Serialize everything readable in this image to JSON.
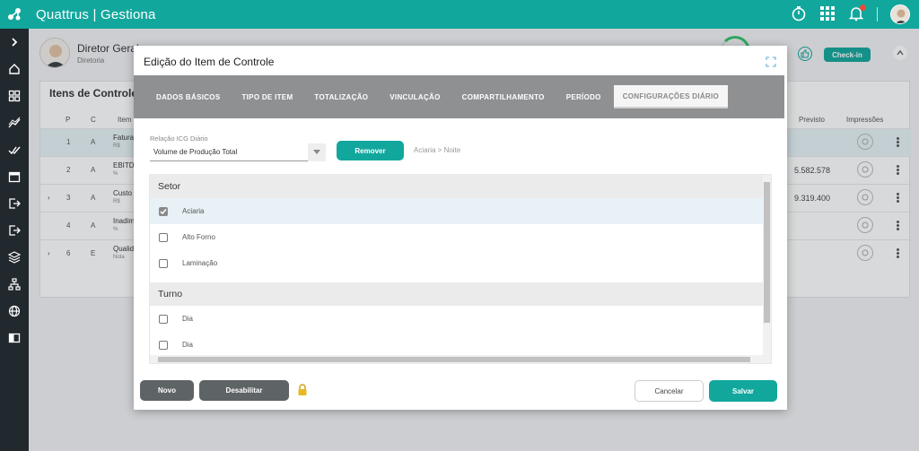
{
  "app": {
    "brand": "Quattrus | Gestiona"
  },
  "user": {
    "name": "Diretor Geral",
    "role": "Diretoria"
  },
  "checkin_label": "Check-in",
  "panel": {
    "title": "Itens de Controle | 5",
    "columns": {
      "p": "P",
      "c": "C",
      "item": "Item",
      "previsto": "Previsto",
      "impressoes": "Impressões"
    },
    "rows": [
      {
        "p": "1",
        "c": "A",
        "item": "Fatura",
        "unit": "R$",
        "previsto": "",
        "expand": ""
      },
      {
        "p": "2",
        "c": "A",
        "item": "EBITDA",
        "unit": "%",
        "previsto": "5.582.578",
        "expand": ""
      },
      {
        "p": "3",
        "c": "A",
        "item": "Custo",
        "unit": "R$",
        "previsto": "9.319.400",
        "expand": "›"
      },
      {
        "p": "4",
        "c": "A",
        "item": "Inadim",
        "unit": "%",
        "previsto": "",
        "expand": ""
      },
      {
        "p": "6",
        "c": "E",
        "item": "Qualid",
        "unit": "Nota",
        "previsto": "",
        "expand": "›"
      }
    ]
  },
  "modal": {
    "title": "Edição do Item de Controle",
    "tabs": [
      "DADOS BÁSICOS",
      "TIPO DE ITEM",
      "TOTALIZAÇÃO",
      "VINCULAÇÃO",
      "COMPARTILHAMENTO",
      "PERÍODO",
      "CONFIGURAÇÕES DIÁRIO"
    ],
    "active_tab": "CONFIGURAÇÕES DIÁRIO",
    "relacao_label": "Relação ICG Diário",
    "relacao_value": "Volume de Produção Total",
    "remove_button": "Remover",
    "breadcrumb": "Aciaria > Noite",
    "groups": [
      {
        "title": "Setor",
        "options": [
          {
            "label": "Aciaria",
            "checked": true
          },
          {
            "label": "Alto Forno",
            "checked": false
          },
          {
            "label": "Laminação",
            "checked": false
          }
        ]
      },
      {
        "title": "Turno",
        "options": [
          {
            "label": "Dia",
            "checked": false
          },
          {
            "label": "Dia",
            "checked": false
          }
        ]
      }
    ],
    "footer": {
      "novo": "Novo",
      "desabilitar": "Desabilitar",
      "cancelar": "Cancelar",
      "salvar": "Salvar"
    }
  },
  "colors": {
    "accent": "#12a79d",
    "sidebar": "#22292e",
    "tabs_bg": "#8f9091"
  }
}
